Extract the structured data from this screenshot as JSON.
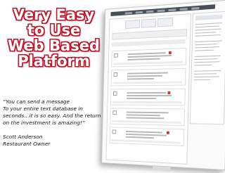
{
  "headline": {
    "lines": [
      "Very Easy",
      "to Use",
      "Web Based",
      "Platform"
    ],
    "fill_color": "#ffffff",
    "outline_color": "#c4152a"
  },
  "quote": {
    "lines": [
      "“You can send a message",
      "To your entire text database in",
      "seconds…it is so easy.  And the return",
      "on the investment is amazing!”"
    ],
    "author": "Scott Anderson",
    "author_title": "Restaurant Owner"
  }
}
